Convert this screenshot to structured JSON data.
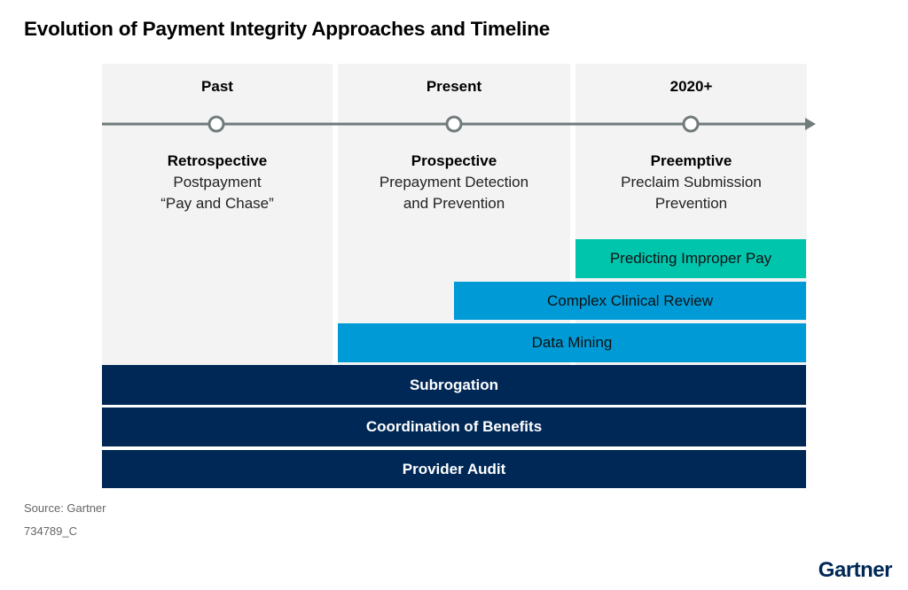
{
  "title": "Evolution of Payment Integrity Approaches and Timeline",
  "eras": [
    {
      "label": "Past",
      "approach": "Retrospective",
      "line1": "Postpayment",
      "line2": "“Pay and Chase”"
    },
    {
      "label": "Present",
      "approach": "Prospective",
      "line1": "Prepayment Detection",
      "line2": "and Prevention"
    },
    {
      "label": "2020+",
      "approach": "Preemptive",
      "line1": "Preclaim Submission",
      "line2": "Prevention"
    }
  ],
  "bars": [
    {
      "label": "Predicting Improper Pay",
      "starts_in": "2020+",
      "color": "#00c5ad"
    },
    {
      "label": "Complex Clinical Review",
      "starts_in": "Present (midpoint)",
      "color": "#009bd6"
    },
    {
      "label": "Data Mining",
      "starts_in": "Present",
      "color": "#009bd6"
    },
    {
      "label": "Subrogation",
      "starts_in": "Past",
      "color": "#002856"
    },
    {
      "label": "Coordination of Benefits",
      "starts_in": "Past",
      "color": "#002856"
    },
    {
      "label": "Provider Audit",
      "starts_in": "Past",
      "color": "#002856"
    }
  ],
  "footer": {
    "source": "Source: Gartner",
    "doc_id": "734789_C",
    "logo": "Gartner"
  }
}
